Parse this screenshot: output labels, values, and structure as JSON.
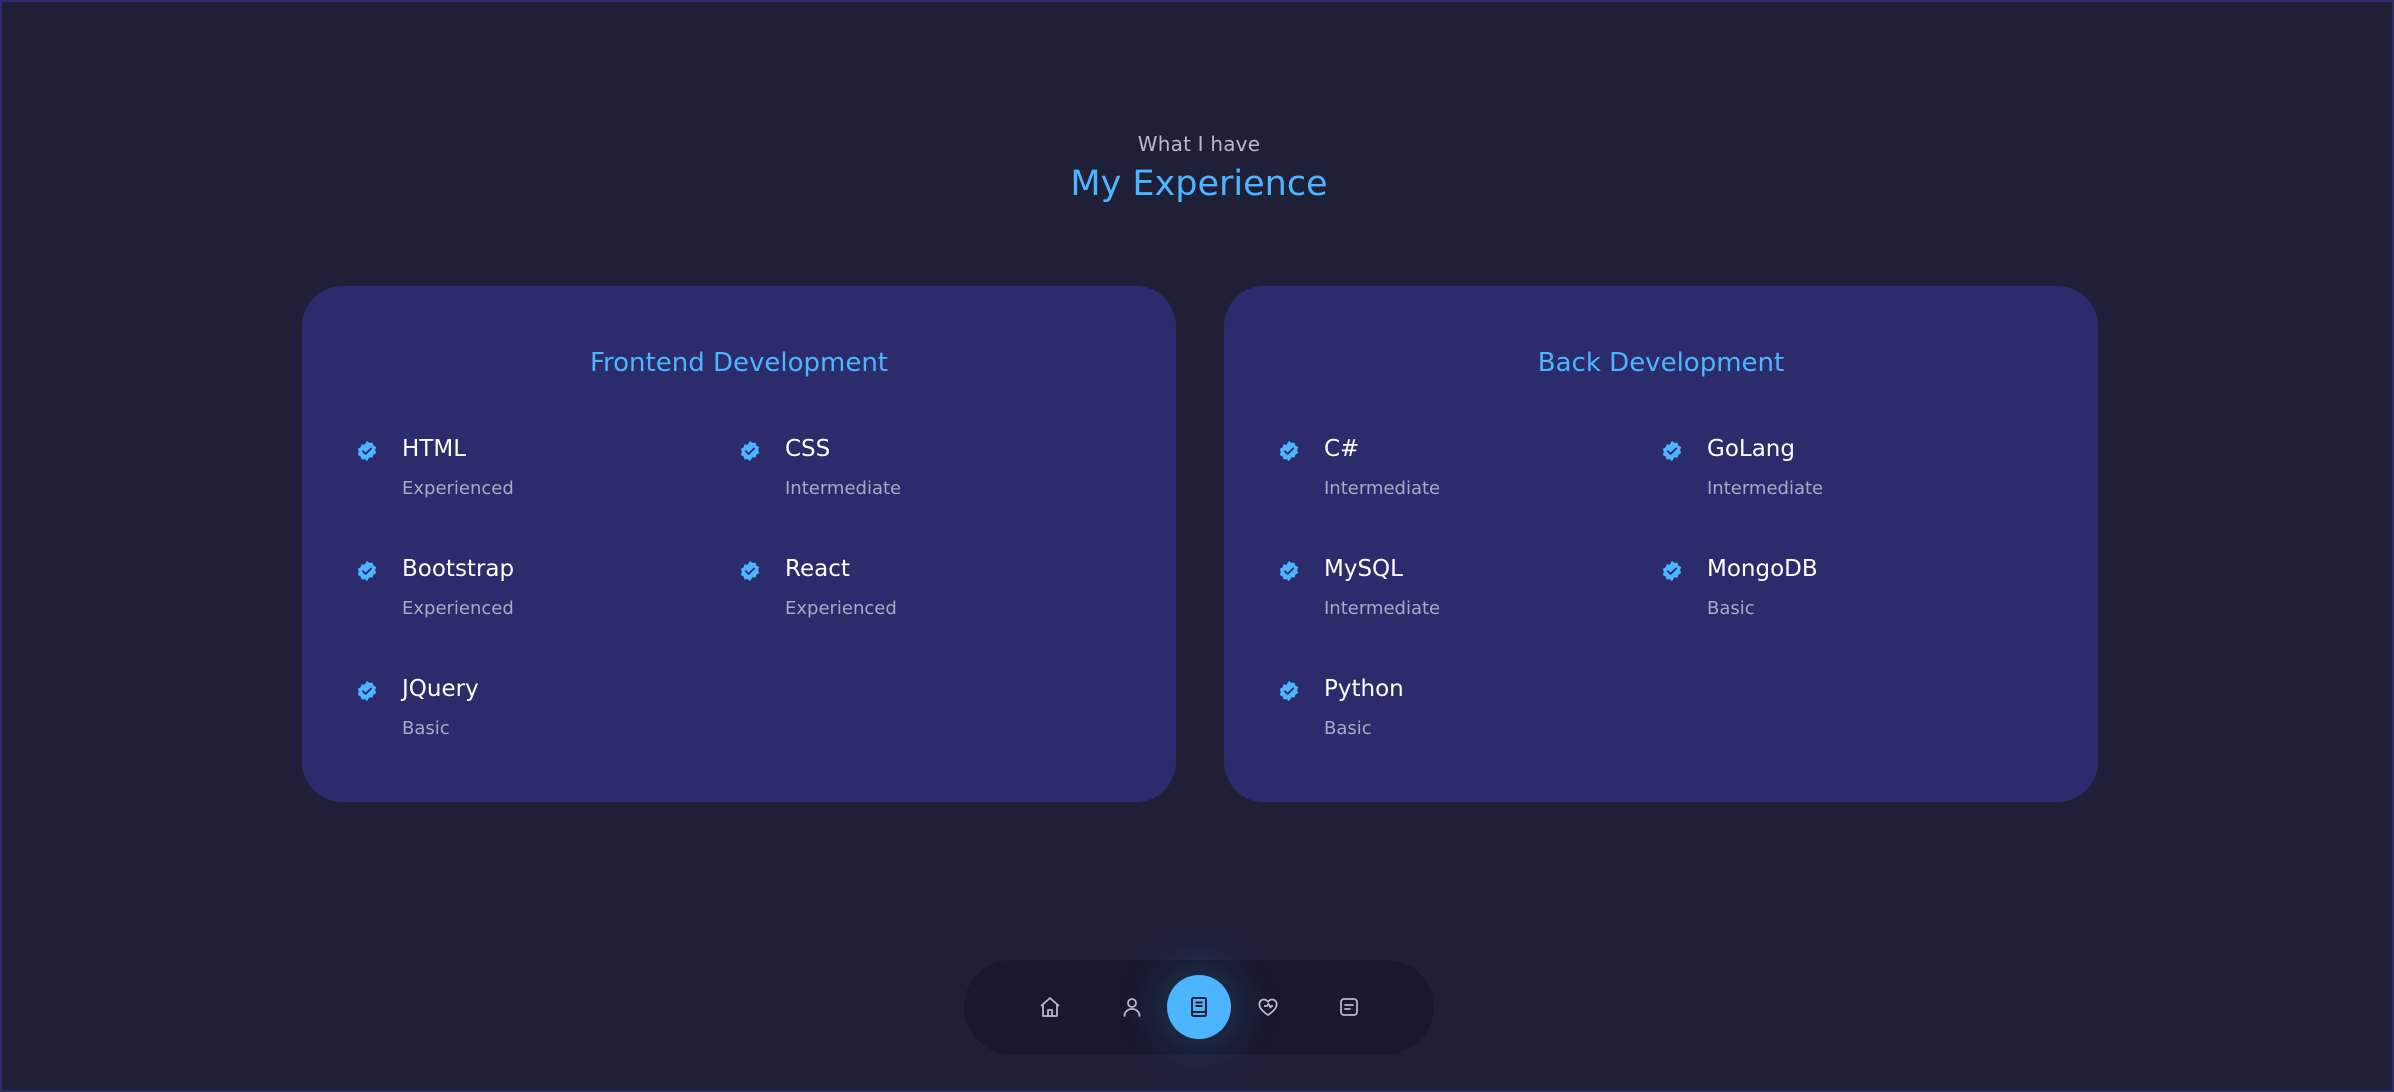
{
  "header": {
    "eyebrow": "What I have",
    "title": "My Experience"
  },
  "cards": [
    {
      "title": "Frontend Development",
      "skills": [
        {
          "name": "HTML",
          "level": "Experienced"
        },
        {
          "name": "CSS",
          "level": "Intermediate"
        },
        {
          "name": "Bootstrap",
          "level": "Experienced"
        },
        {
          "name": "React",
          "level": "Experienced"
        },
        {
          "name": "JQuery",
          "level": "Basic"
        }
      ]
    },
    {
      "title": "Back Development",
      "skills": [
        {
          "name": "C#",
          "level": "Intermediate"
        },
        {
          "name": "GoLang",
          "level": "Intermediate"
        },
        {
          "name": "MySQL",
          "level": "Intermediate"
        },
        {
          "name": "MongoDB",
          "level": "Basic"
        },
        {
          "name": "Python",
          "level": "Basic"
        }
      ]
    }
  ],
  "icons": {
    "skill_check": "verified-check-icon"
  },
  "nav": {
    "items": [
      {
        "icon": "home-icon",
        "active": false
      },
      {
        "icon": "user-icon",
        "active": false
      },
      {
        "icon": "book-icon",
        "active": true
      },
      {
        "icon": "services-icon",
        "active": false
      },
      {
        "icon": "message-icon",
        "active": false
      }
    ]
  },
  "colors": {
    "background": "#1f1f38",
    "card": "#2c2c6c",
    "accent": "#4db5ff",
    "text": "#ffffff",
    "muted": "#a9a9c4"
  }
}
